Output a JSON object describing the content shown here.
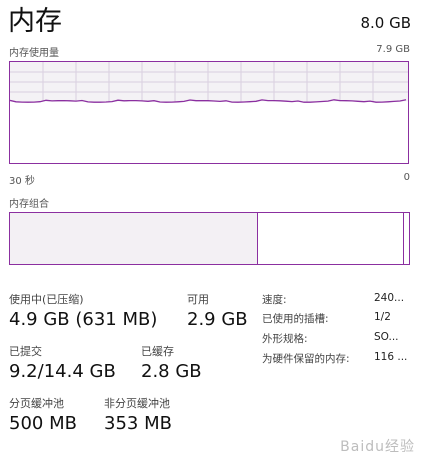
{
  "header": {
    "title": "内存",
    "total": "8.0 GB"
  },
  "usage_graph": {
    "label": "内存使用量",
    "max_label": "7.9 GB",
    "time_label": "30 秒",
    "zero_label": "0",
    "usage_fraction": 0.61,
    "line_color": "#8b2fa0"
  },
  "composition": {
    "label": "内存组合",
    "in_use_fraction": 0.62
  },
  "stats": {
    "in_use_label": "使用中(已压缩)",
    "in_use_value": "4.9 GB (631 MB)",
    "available_label": "可用",
    "available_value": "2.9 GB",
    "committed_label": "已提交",
    "committed_value": "9.2/14.4 GB",
    "cached_label": "已缓存",
    "cached_value": "2.8 GB",
    "paged_pool_label": "分页缓冲池",
    "paged_pool_value": "500 MB",
    "nonpaged_pool_label": "非分页缓冲池",
    "nonpaged_pool_value": "353 MB"
  },
  "details": {
    "speed_label": "速度:",
    "speed_value": "240...",
    "slots_label": "已使用的插槽:",
    "slots_value": "1/2",
    "form_label": "外形规格:",
    "form_value": "SO...",
    "reserved_label": "为硬件保留的内存:",
    "reserved_value": "116 ..."
  },
  "watermark": "Baidu经验"
}
